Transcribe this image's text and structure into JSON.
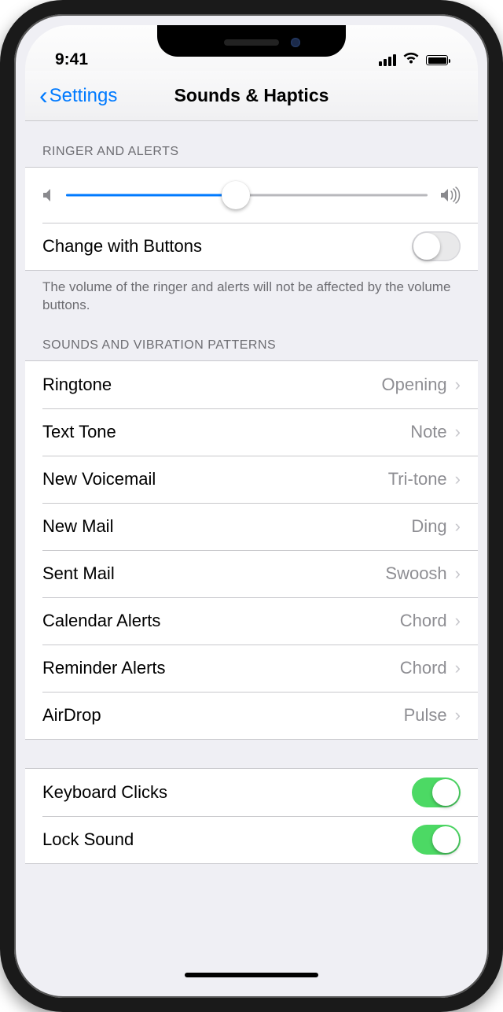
{
  "statusbar": {
    "time": "9:41"
  },
  "nav": {
    "back": "Settings",
    "title": "Sounds & Haptics"
  },
  "ringer": {
    "header": "RINGER AND ALERTS",
    "slider_percent": 47,
    "change_label": "Change with Buttons",
    "change_on": false,
    "footer": "The volume of the ringer and alerts will not be affected by the volume buttons."
  },
  "patterns": {
    "header": "SOUNDS AND VIBRATION PATTERNS",
    "items": [
      {
        "label": "Ringtone",
        "value": "Opening"
      },
      {
        "label": "Text Tone",
        "value": "Note"
      },
      {
        "label": "New Voicemail",
        "value": "Tri-tone"
      },
      {
        "label": "New Mail",
        "value": "Ding"
      },
      {
        "label": "Sent Mail",
        "value": "Swoosh"
      },
      {
        "label": "Calendar Alerts",
        "value": "Chord"
      },
      {
        "label": "Reminder Alerts",
        "value": "Chord"
      },
      {
        "label": "AirDrop",
        "value": "Pulse"
      }
    ]
  },
  "system": {
    "keyboard_label": "Keyboard Clicks",
    "keyboard_on": true,
    "lock_label": "Lock Sound",
    "lock_on": true
  }
}
